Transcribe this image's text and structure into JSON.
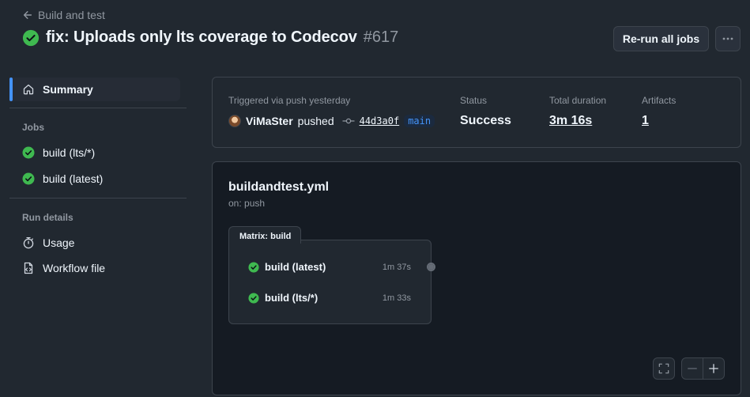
{
  "header": {
    "back_label": "Build and test",
    "title": "fix: Uploads only lts coverage to Codecov",
    "run_number": "#617",
    "rerun_label": "Re-run all jobs",
    "more_label": "···"
  },
  "sidebar": {
    "summary_label": "Summary",
    "jobs_heading": "Jobs",
    "jobs": [
      {
        "label": "build (lts/*)",
        "status": "success"
      },
      {
        "label": "build (latest)",
        "status": "success"
      }
    ],
    "run_details_heading": "Run details",
    "usage_label": "Usage",
    "workflow_file_label": "Workflow file"
  },
  "summary": {
    "trigger_text": "Triggered via push yesterday",
    "actor": "ViMaSter",
    "actor_action": "pushed",
    "commit_sha": "44d3a0f",
    "branch": "main",
    "status_label": "Status",
    "status_value": "Success",
    "duration_label": "Total duration",
    "duration_value": "3m 16s",
    "artifacts_label": "Artifacts",
    "artifacts_value": "1"
  },
  "graph": {
    "workflow_file": "buildandtest.yml",
    "trigger": "on: push",
    "matrix_label": "Matrix: build",
    "jobs": [
      {
        "label": "build (latest)",
        "duration": "1m 37s"
      },
      {
        "label": "build (lts/*)",
        "duration": "1m 33s"
      }
    ]
  },
  "colors": {
    "success": "#3fb950",
    "accent": "#4493f8",
    "background": "#212830",
    "border": "#3d444d"
  },
  "icons": [
    "arrow-left-icon",
    "check-circle-icon",
    "home-icon",
    "stopwatch-icon",
    "workflow-file-icon",
    "commit-icon",
    "fullscreen-icon",
    "zoom-out-icon",
    "zoom-in-icon",
    "kebab-icon"
  ]
}
